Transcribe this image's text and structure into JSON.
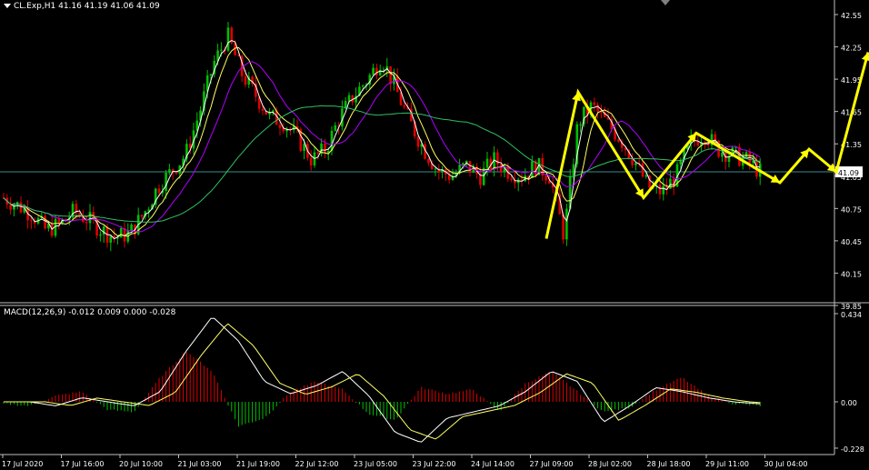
{
  "header": {
    "symbol_line": "CL.Exp,H1  41.16 41.19 41.06 41.09",
    "macd_line": "MACD(12,26,9) -0.012 0.009 0.000 -0.028"
  },
  "colors": {
    "bull": "#00c000",
    "bear": "#e00000",
    "ma_fast": "#ffffff",
    "ma_mid": "#ffff66",
    "ma_slow": "#b000ff",
    "ma_long": "#30c060",
    "arrows": "#ffff00",
    "grid_line": "#888888",
    "current_line": "#3c8c8c"
  },
  "price_scale": {
    "min": 39.85,
    "max": 42.55,
    "ticks": [
      "42.55",
      "42.25",
      "41.95",
      "41.65",
      "41.35",
      "41.05",
      "40.75",
      "40.45",
      "40.15",
      "39.85"
    ],
    "current_label": "41.09"
  },
  "macd_scale": {
    "ticks": [
      "0.434",
      "0.00",
      "-0.228"
    ]
  },
  "time_axis": {
    "labels": [
      "17 Jul 2020",
      "17 Jul 16:00",
      "20 Jul 10:00",
      "21 Jul 03:00",
      "21 Jul 19:00",
      "22 Jul 12:00",
      "23 Jul 05:00",
      "23 Jul 22:00",
      "24 Jul 14:00",
      "27 Jul 09:00",
      "28 Jul 02:00",
      "28 Jul 18:00",
      "29 Jul 11:00",
      "30 Jul 04:00"
    ]
  },
  "chart_data": {
    "type": "line",
    "description_source": "price path and forecast arrows read from chart",
    "price_path": [
      40.85,
      40.78,
      40.7,
      40.55,
      40.6,
      40.72,
      40.65,
      40.55,
      40.48,
      40.52,
      40.7,
      40.95,
      41.1,
      41.25,
      41.65,
      42.1,
      42.35,
      42.0,
      41.8,
      41.6,
      41.55,
      41.4,
      41.2,
      41.3,
      41.6,
      41.8,
      41.95,
      42.15,
      41.85,
      41.55,
      41.3,
      41.1,
      41.05,
      41.15,
      41.05,
      41.2,
      41.1,
      41.05,
      41.15,
      41.05,
      40.5,
      41.55,
      41.7,
      41.55,
      41.4,
      41.2,
      40.95,
      40.9,
      41.05,
      41.35,
      41.45,
      41.3,
      41.25,
      41.2,
      41.09
    ],
    "forecast_arrows": [
      41.09,
      40.98,
      41.25,
      41.1,
      42.3
    ],
    "macd_histogram": [
      -0.01,
      -0.02,
      0.03,
      0.05,
      -0.04,
      -0.05,
      0.12,
      0.25,
      0.15,
      -0.12,
      -0.08,
      0.05,
      0.1,
      0.06,
      -0.06,
      -0.09,
      0.07,
      0.04,
      0.06,
      -0.05,
      0.09,
      0.15,
      0.05,
      -0.05,
      -0.03,
      0.06,
      0.12,
      0.03,
      -0.01,
      -0.02
    ],
    "macd_signal": [
      0.0,
      0.0,
      -0.02,
      0.02,
      0.0,
      -0.02,
      0.05,
      0.25,
      0.42,
      0.3,
      0.1,
      0.04,
      0.08,
      0.15,
      0.03,
      -0.15,
      -0.2,
      -0.08,
      -0.05,
      -0.02,
      0.05,
      0.15,
      0.1,
      -0.1,
      -0.02,
      0.07,
      0.05,
      0.02,
      0.0,
      -0.01
    ]
  }
}
